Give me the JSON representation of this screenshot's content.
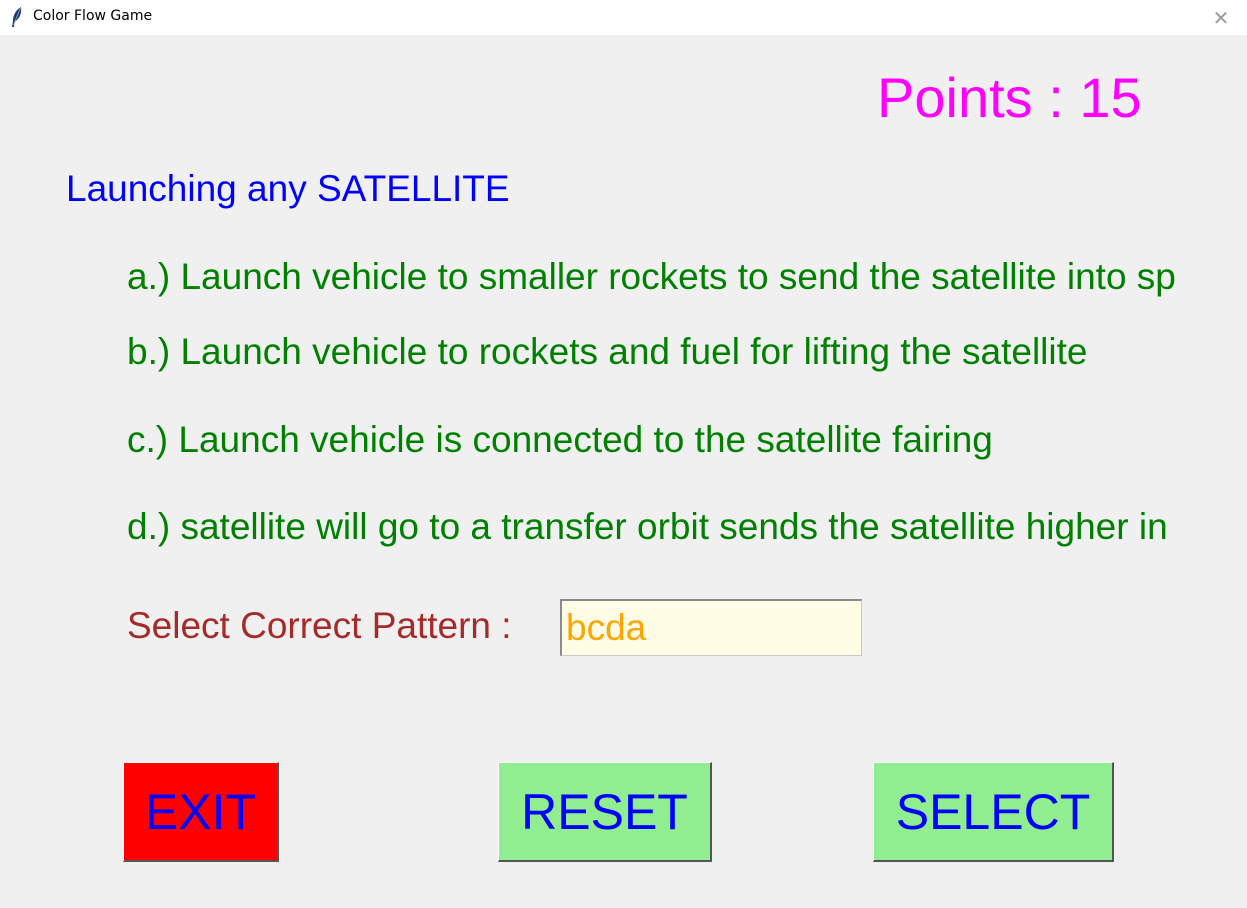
{
  "window": {
    "title": "Color Flow Game",
    "close_symbol": "✕"
  },
  "score": {
    "text": "Points : 15"
  },
  "question": {
    "title": "Launching any SATELLITE",
    "options": [
      "a.) Launch vehicle to smaller rockets to send the satellite into sp",
      "b.) Launch vehicle to rockets and fuel for lifting the satellite",
      "c.) Launch vehicle is connected to the satellite fairing",
      "d.) satellite will go to a transfer orbit sends the satellite higher in"
    ]
  },
  "answer": {
    "label": "Select Correct Pattern :",
    "value": "bcda"
  },
  "buttons": {
    "exit": "EXIT",
    "reset": "RESET",
    "select": "SELECT"
  },
  "colors": {
    "points": "#ff00ff",
    "question": "#0000ff",
    "options": "#008000",
    "prompt": "#a52a2a",
    "answer_text": "#ffa500",
    "exit_bg": "#ff0000",
    "action_bg": "#90ee90"
  },
  "icons": {
    "app": "feather-icon",
    "close": "close-icon"
  }
}
